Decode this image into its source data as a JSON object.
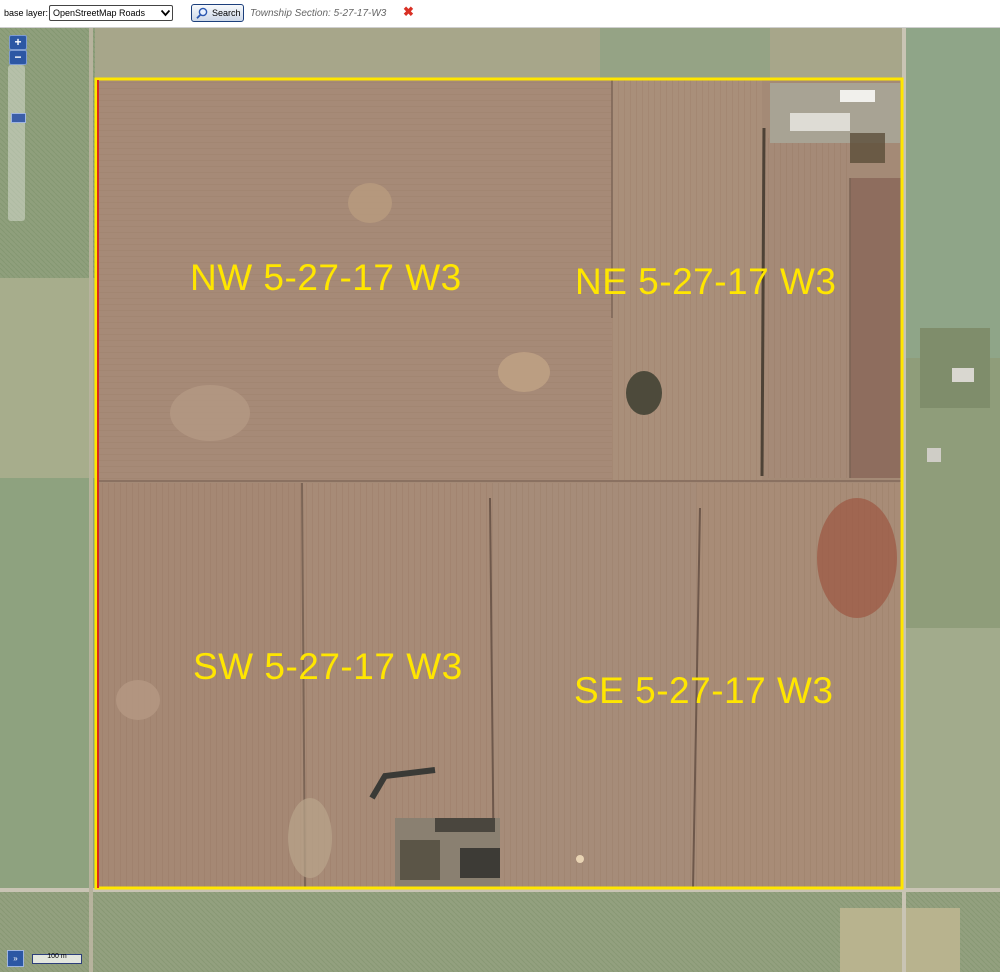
{
  "toolbar": {
    "base_layer_label": "base layer:",
    "base_layer_value": "OpenStreetMap Roads",
    "search_label": "Search",
    "section_text": "Township Section: 5-27-17-W3",
    "close_glyph": "✖"
  },
  "map": {
    "zoom_in": "+",
    "zoom_out": "−",
    "layer_switcher_glyph": "»",
    "scale": "100 m",
    "quarters": {
      "nw": "NW 5-27-17 W3",
      "ne": "NE 5-27-17 W3",
      "sw": "SW 5-27-17 W3",
      "se": "SE 5-27-17 W3"
    },
    "boundary_color": "#ffe600",
    "label_color": "#ffe600"
  }
}
